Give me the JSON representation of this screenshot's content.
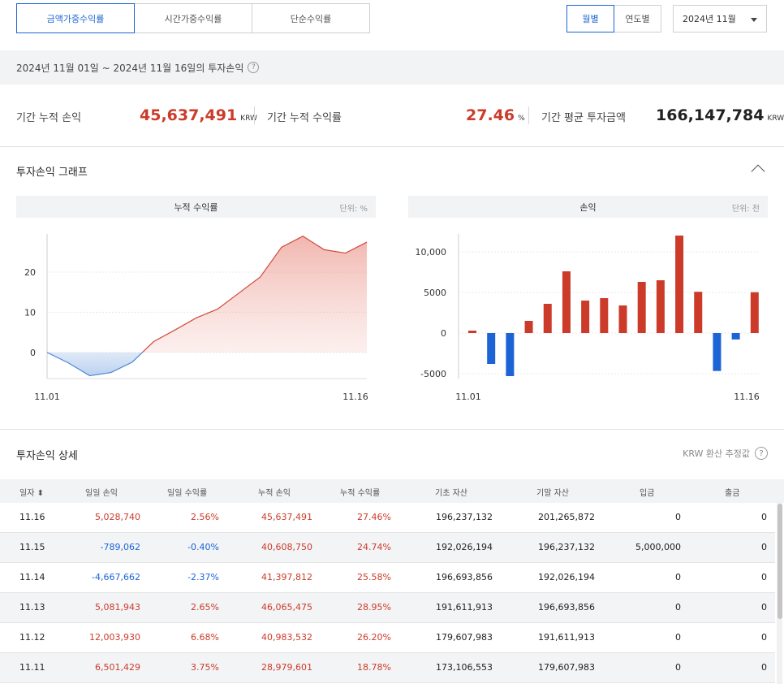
{
  "tabs": [
    {
      "label": "금액가중수익률",
      "active": true
    },
    {
      "label": "시간가중수익률",
      "active": false
    },
    {
      "label": "단순수익률",
      "active": false
    }
  ],
  "period_buttons": [
    {
      "label": "월별",
      "active": true
    },
    {
      "label": "연도별",
      "active": false
    }
  ],
  "month_select": {
    "value": "2024년 11월"
  },
  "period_bar": {
    "text": "2024년 11월 01일 ~ 2024년 11월 16일의 투자손익",
    "help": "?"
  },
  "summary": {
    "cum_pl": {
      "label": "기간 누적 손익",
      "value": "45,637,491",
      "unit": "KRW"
    },
    "cum_return": {
      "label": "기간 누적 수익률",
      "value": "27.46",
      "unit": "%"
    },
    "avg_invest": {
      "label": "기간 평균 투자금액",
      "value": "166,147,784",
      "unit": "KRW"
    }
  },
  "graph_section": {
    "title": "투자손익 그래프"
  },
  "colors": {
    "positive": "#cc3b2a",
    "negative": "#1c64d6",
    "accent": "#1c64d6"
  },
  "chart_data": [
    {
      "type": "area",
      "title": "누적 수익률",
      "unit_label": "단위: %",
      "x": [
        "11.01",
        "11.02",
        "11.03",
        "11.04",
        "11.05",
        "11.06",
        "11.07",
        "11.08",
        "11.09",
        "11.10",
        "11.11",
        "11.12",
        "11.13",
        "11.14",
        "11.15",
        "11.16"
      ],
      "y": [
        0,
        -2.6,
        -5.8,
        -5.0,
        -2.4,
        2.7,
        5.6,
        8.6,
        10.8,
        14.8,
        18.78,
        26.2,
        28.95,
        25.58,
        24.74,
        27.46
      ],
      "x_tick_labels": [
        "11.01",
        "11.16"
      ],
      "y_ticks": [
        0,
        10,
        20
      ],
      "ylim": [
        -6.5,
        29.5
      ],
      "grid": true
    },
    {
      "type": "bar",
      "title": "손익",
      "unit_label": "단위: 천",
      "x": [
        "11.01",
        "11.02",
        "11.03",
        "11.04",
        "11.05",
        "11.06",
        "11.07",
        "11.08",
        "11.09",
        "11.10",
        "11.11",
        "11.12",
        "11.13",
        "11.14",
        "11.15",
        "11.16"
      ],
      "values": [
        300,
        -3800,
        -5300,
        1500,
        3600,
        7600,
        4000,
        4300,
        3400,
        6300,
        6501,
        12004,
        5082,
        -4668,
        -789,
        5029
      ],
      "x_tick_labels": [
        "11.01",
        "11.16"
      ],
      "y_ticks": [
        -5000,
        0,
        5000,
        10000
      ],
      "y_tick_labels": [
        "-5000",
        "0",
        "5000",
        "10,000"
      ],
      "ylim": [
        -5600,
        12200
      ],
      "grid": true
    }
  ],
  "detail_section": {
    "title": "투자손익 상세",
    "krw_note": "KRW 환산 추정값",
    "help": "?"
  },
  "table": {
    "headers": [
      "일자 ⬍",
      "일일 손익",
      "일일 수익률",
      "누적 손익",
      "누적 수익률",
      "기초 자산",
      "기말 자산",
      "입금",
      "출금"
    ],
    "rows": [
      {
        "date": "11.16",
        "daily_pl": "5,028,740",
        "daily_ret": "2.56%",
        "cum_pl": "45,637,491",
        "cum_ret": "27.46%",
        "begin": "196,237,132",
        "end": "201,265,872",
        "deposit": "0",
        "withdraw": "0",
        "sign": "pos"
      },
      {
        "date": "11.15",
        "daily_pl": "-789,062",
        "daily_ret": "-0.40%",
        "cum_pl": "40,608,750",
        "cum_ret": "24.74%",
        "begin": "192,026,194",
        "end": "196,237,132",
        "deposit": "5,000,000",
        "withdraw": "0",
        "sign": "neg"
      },
      {
        "date": "11.14",
        "daily_pl": "-4,667,662",
        "daily_ret": "-2.37%",
        "cum_pl": "41,397,812",
        "cum_ret": "25.58%",
        "begin": "196,693,856",
        "end": "192,026,194",
        "deposit": "0",
        "withdraw": "0",
        "sign": "neg"
      },
      {
        "date": "11.13",
        "daily_pl": "5,081,943",
        "daily_ret": "2.65%",
        "cum_pl": "46,065,475",
        "cum_ret": "28.95%",
        "begin": "191,611,913",
        "end": "196,693,856",
        "deposit": "0",
        "withdraw": "0",
        "sign": "pos"
      },
      {
        "date": "11.12",
        "daily_pl": "12,003,930",
        "daily_ret": "6.68%",
        "cum_pl": "40,983,532",
        "cum_ret": "26.20%",
        "begin": "179,607,983",
        "end": "191,611,913",
        "deposit": "0",
        "withdraw": "0",
        "sign": "pos"
      },
      {
        "date": "11.11",
        "daily_pl": "6,501,429",
        "daily_ret": "3.75%",
        "cum_pl": "28,979,601",
        "cum_ret": "18.78%",
        "begin": "173,106,553",
        "end": "179,607,983",
        "deposit": "0",
        "withdraw": "0",
        "sign": "pos"
      }
    ]
  }
}
